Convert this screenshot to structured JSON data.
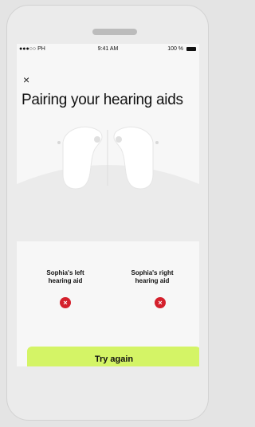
{
  "status_bar": {
    "carrier": "●●●○○ PH",
    "time": "9:41 AM",
    "battery": "100 %"
  },
  "close_glyph": "×",
  "page_title": "Pairing your hearing aids",
  "devices": [
    {
      "label": "Sophia's left\nhearing aid",
      "status": "error"
    },
    {
      "label": "Sophia's right\nhearing aid",
      "status": "error"
    }
  ],
  "error_glyph": "×",
  "button": {
    "label": "Try again"
  },
  "colors": {
    "accent": "#d4f466",
    "error": "#d4202c"
  }
}
